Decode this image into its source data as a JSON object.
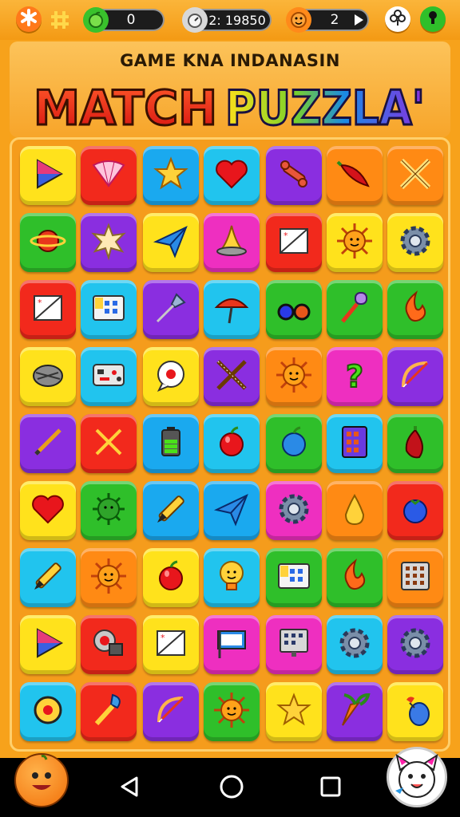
{
  "topbar": {
    "apples": "0",
    "timer": "2: 19850",
    "gems": "2"
  },
  "header": {
    "subtitle": "GAME KNA INDANASIN",
    "title_part1": "MATCH",
    "title_part2": "PUZZLA'"
  },
  "colors": {
    "yellow": "#ffe21c",
    "red": "#f2291c",
    "blue": "#1aa9ef",
    "cyan": "#21c4ee",
    "purple": "#8a2ee0",
    "orange": "#ff8a14",
    "green": "#2fbf2a",
    "magenta": "#ee2fc0"
  },
  "board": [
    [
      {
        "c": "yellow",
        "i": "play-triangle-icon"
      },
      {
        "c": "red",
        "i": "paper-fan-icon"
      },
      {
        "c": "blue",
        "i": "star-icon"
      },
      {
        "c": "cyan",
        "i": "heart-icon"
      },
      {
        "c": "purple",
        "i": "wrench-icon"
      },
      {
        "c": "orange",
        "i": "chili-icon"
      },
      {
        "c": "orange",
        "i": "crossed-pencils-icon"
      }
    ],
    [
      {
        "c": "green",
        "i": "planet-icon"
      },
      {
        "c": "purple",
        "i": "star-flower-icon"
      },
      {
        "c": "yellow",
        "i": "paper-plane-icon"
      },
      {
        "c": "magenta",
        "i": "wizard-hat-icon"
      },
      {
        "c": "red",
        "i": "card-icon"
      },
      {
        "c": "yellow",
        "i": "sun-icon"
      },
      {
        "c": "yellow",
        "i": "gear-icon"
      }
    ],
    [
      {
        "c": "red",
        "i": "card-icon"
      },
      {
        "c": "cyan",
        "i": "keypad-icon"
      },
      {
        "c": "purple",
        "i": "pin-icon"
      },
      {
        "c": "cyan",
        "i": "umbrella-icon"
      },
      {
        "c": "green",
        "i": "glasses-icon"
      },
      {
        "c": "green",
        "i": "mallet-icon"
      },
      {
        "c": "green",
        "i": "flame-icon"
      }
    ],
    [
      {
        "c": "yellow",
        "i": "stone-icon"
      },
      {
        "c": "cyan",
        "i": "console-icon"
      },
      {
        "c": "yellow",
        "i": "chat-bubble-icon"
      },
      {
        "c": "purple",
        "i": "crossed-swords-icon"
      },
      {
        "c": "orange",
        "i": "sun-icon"
      },
      {
        "c": "magenta",
        "i": "question-icon"
      },
      {
        "c": "purple",
        "i": "bow-icon"
      }
    ],
    [
      {
        "c": "purple",
        "i": "pencil-icon"
      },
      {
        "c": "red",
        "i": "crossed-sticks-icon"
      },
      {
        "c": "blue",
        "i": "battery-icon"
      },
      {
        "c": "cyan",
        "i": "apple-icon"
      },
      {
        "c": "green",
        "i": "blue-apple-icon"
      },
      {
        "c": "cyan",
        "i": "calculator-icon"
      },
      {
        "c": "green",
        "i": "pepper-icon"
      }
    ],
    [
      {
        "c": "yellow",
        "i": "heart-icon"
      },
      {
        "c": "green",
        "i": "virus-icon"
      },
      {
        "c": "blue",
        "i": "crayon-icon"
      },
      {
        "c": "blue",
        "i": "paper-plane-icon"
      },
      {
        "c": "magenta",
        "i": "gear-icon"
      },
      {
        "c": "orange",
        "i": "pear-icon"
      },
      {
        "c": "red",
        "i": "blueberry-icon"
      }
    ],
    [
      {
        "c": "cyan",
        "i": "crayon-icon"
      },
      {
        "c": "orange",
        "i": "sun-icon"
      },
      {
        "c": "yellow",
        "i": "apple-icon"
      },
      {
        "c": "cyan",
        "i": "lightbulb-icon"
      },
      {
        "c": "green",
        "i": "keypad-icon"
      },
      {
        "c": "green",
        "i": "flame-icon"
      },
      {
        "c": "orange",
        "i": "abacus-icon"
      }
    ],
    [
      {
        "c": "yellow",
        "i": "play-triangle-icon"
      },
      {
        "c": "red",
        "i": "target-icon"
      },
      {
        "c": "yellow",
        "i": "card-icon"
      },
      {
        "c": "magenta",
        "i": "flag-icon"
      },
      {
        "c": "magenta",
        "i": "monitor-icon"
      },
      {
        "c": "cyan",
        "i": "gear-icon"
      },
      {
        "c": "purple",
        "i": "gear-icon"
      }
    ],
    [
      {
        "c": "cyan",
        "i": "button-icon"
      },
      {
        "c": "red",
        "i": "brush-icon"
      },
      {
        "c": "purple",
        "i": "bow-icon"
      },
      {
        "c": "green",
        "i": "sun-icon"
      },
      {
        "c": "yellow",
        "i": "star-icon"
      },
      {
        "c": "purple",
        "i": "carrot-icon"
      },
      {
        "c": "yellow",
        "i": "balloon-icon"
      }
    ]
  ]
}
